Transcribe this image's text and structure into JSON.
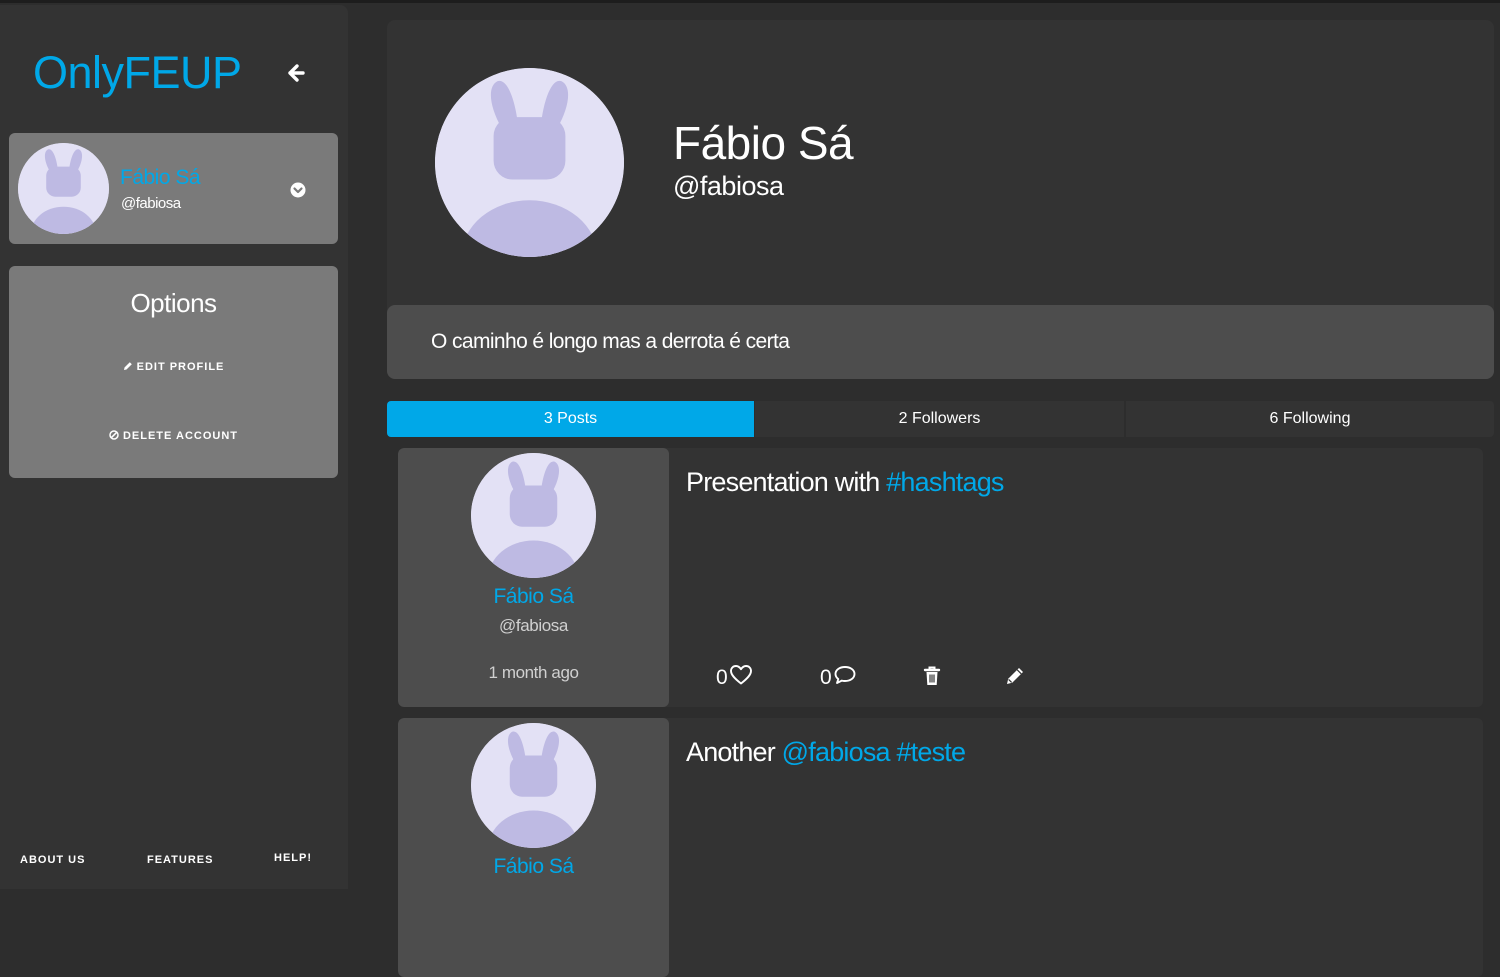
{
  "app": {
    "brand": "OnlyFEUP"
  },
  "colors": {
    "accent": "#00a8e8",
    "card": "#333333",
    "panel": "#7a7a7a",
    "avatar_bg": "#e3e1f5",
    "avatar_fg": "#bebae3"
  },
  "sidebar": {
    "collapse_icon": "arrow-left-icon",
    "user": {
      "name": "Fábio Sá",
      "handle": "@fabiosa",
      "dropdown_icon": "chevron-circle-down-icon"
    },
    "options": {
      "title": "Options",
      "edit_label": "EDIT PROFILE",
      "edit_icon": "pencil-icon",
      "delete_label": "DELETE ACCOUNT",
      "delete_icon": "ban-icon"
    },
    "footer": {
      "about": "ABOUT US",
      "features": "FEATURES",
      "help": "HELP!"
    }
  },
  "profile": {
    "name": "Fábio Sá",
    "handle": "@fabiosa",
    "bio": "O caminho é longo mas a derrota é certa"
  },
  "tabs": [
    {
      "label": "3 Posts",
      "active": true
    },
    {
      "label": "2 Followers",
      "active": false
    },
    {
      "label": "6 Following",
      "active": false
    }
  ],
  "posts": [
    {
      "author": "Fábio Sá",
      "handle": "@fabiosa",
      "time": "1 month ago",
      "text_prefix": "Presentation with ",
      "tag1": "#hashtags",
      "likes": "0",
      "comments": "0"
    },
    {
      "author": "Fábio Sá",
      "text_prefix": "Another ",
      "tag1": "@fabiosa",
      "tag2": "#teste"
    }
  ]
}
